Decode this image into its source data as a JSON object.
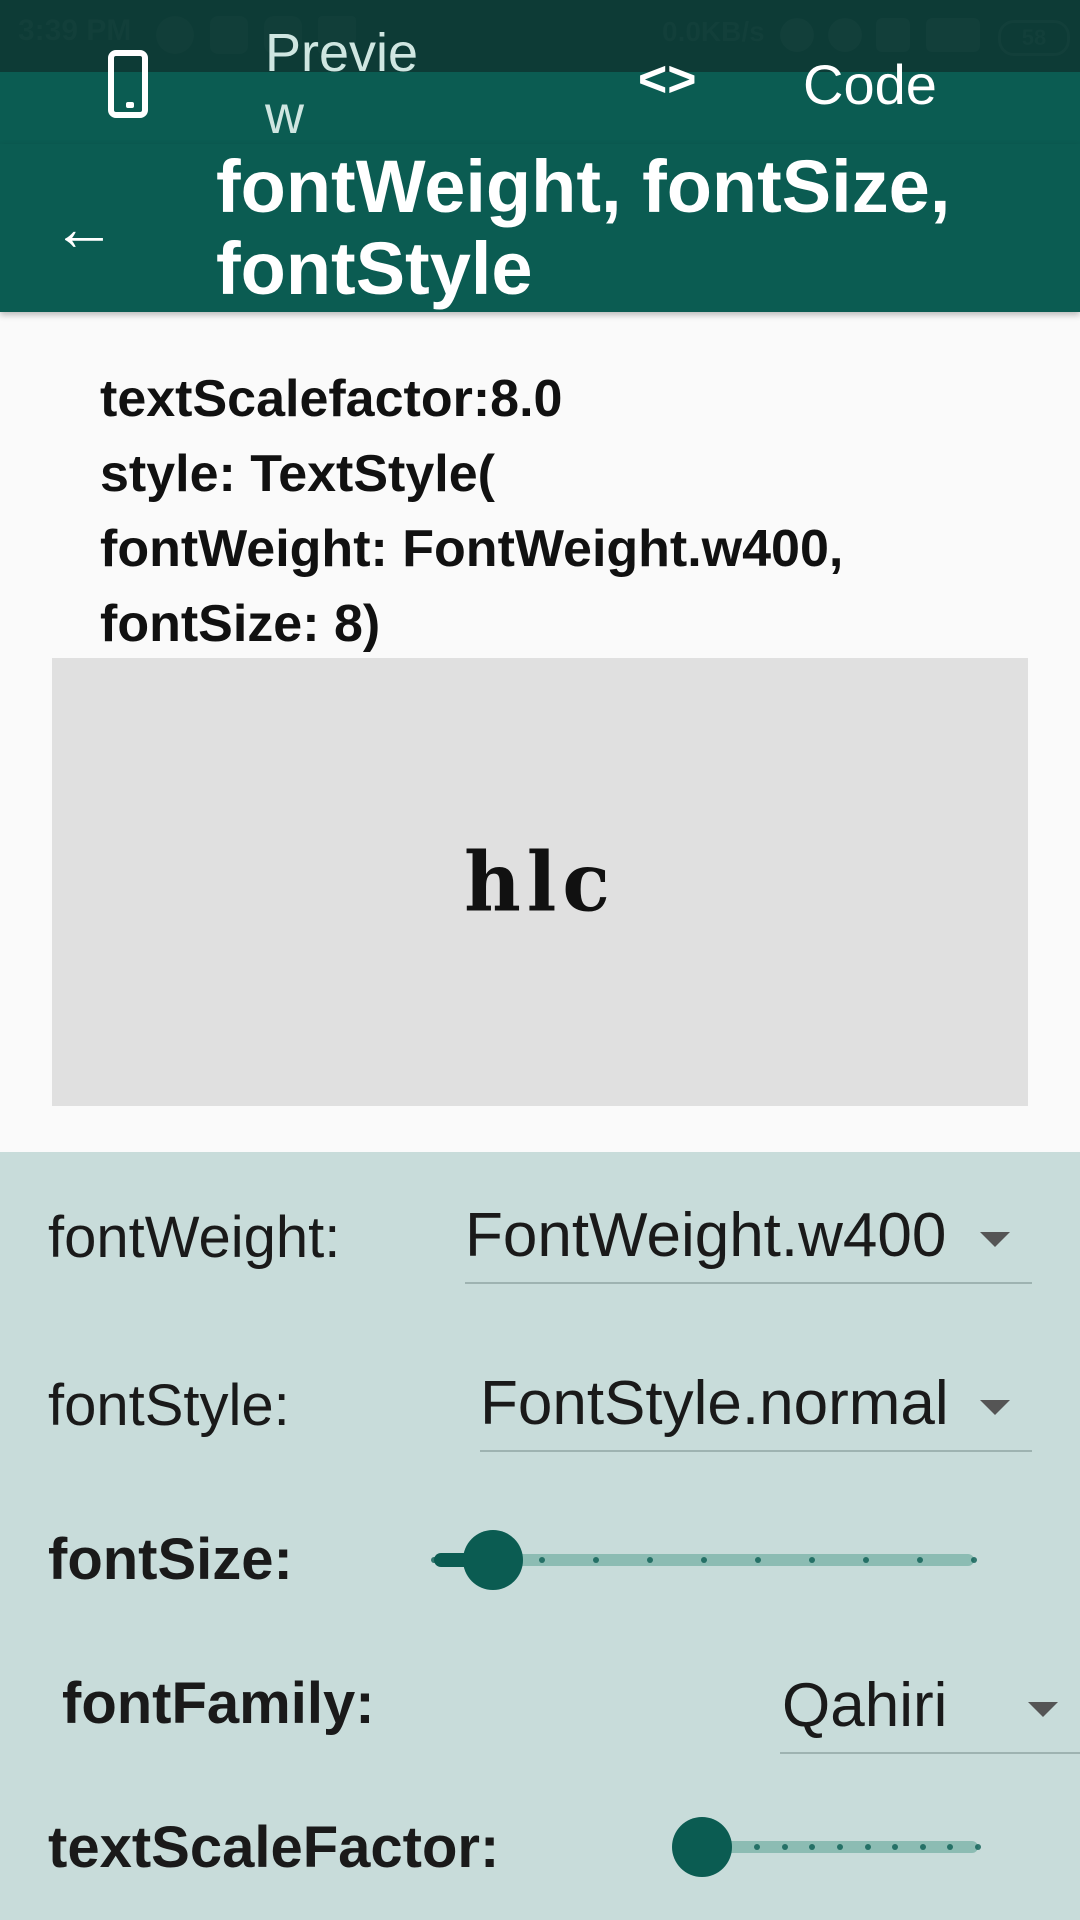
{
  "status_bar": {
    "time": "3:39 PM",
    "network_speed": "0.0KB/s",
    "battery": "58",
    "icons": [
      "whatsapp-icon",
      "youtube-icon",
      "android-icon",
      "warning-icon",
      "mute-icon",
      "alarm-icon",
      "volte-icon",
      "signal-4g-icon",
      "battery-icon"
    ]
  },
  "tabs": {
    "preview_label": "Preview",
    "code_label": "Code",
    "code_icon_text": "<>",
    "preview_icon": "phone-icon"
  },
  "app_bar": {
    "back_icon": "arrow-back-icon",
    "title": "fontWeight, fontSize, fontStyle"
  },
  "description": "textScalefactor:8.0\nstyle: TextStyle(\nfontWeight: FontWeight.w400,\nfontSize: 8)",
  "preview": {
    "sample_text": "hlc"
  },
  "controls": {
    "font_weight": {
      "label": "fontWeight:",
      "value": "FontWeight.w400"
    },
    "font_style": {
      "label": "fontStyle:",
      "value": "FontStyle.normal"
    },
    "font_size": {
      "label": "fontSize:",
      "level": 0.11,
      "divisions": 10
    },
    "font_family": {
      "label": "fontFamily:",
      "value": "Qahiri"
    },
    "text_scale_factor": {
      "label": "textScaleFactor:",
      "level": 0.0,
      "divisions": 10
    }
  },
  "colors": {
    "primary": "#0b5c52",
    "status_bar": "#0d3b36",
    "panel_bg": "#c8dcda",
    "preview_bg": "#e0e0e0"
  }
}
